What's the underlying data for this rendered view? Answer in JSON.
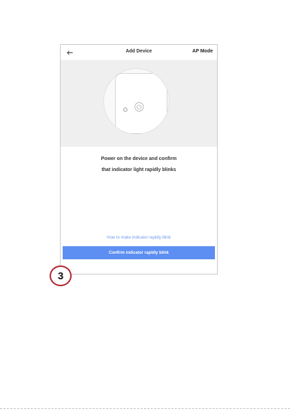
{
  "header": {
    "back_icon": "arrow-left-icon",
    "title": "Add Device",
    "mode_label": "AP Mode"
  },
  "illustration": {
    "power_icon": "power-icon",
    "indicator_icon": "indicator-light-icon"
  },
  "instructions": {
    "line1": "Power on the device and confirm",
    "line2": "that indicator light rapidly blinks"
  },
  "help_link": "How to make indicator rapidly blink",
  "confirm_button": "Confirm indicator rapidly blink",
  "step_badge": "3",
  "colors": {
    "accent": "#5d8ef1",
    "link": "#6f99ea",
    "hero_bg": "#efefef",
    "badge_border": "#b2202c"
  }
}
